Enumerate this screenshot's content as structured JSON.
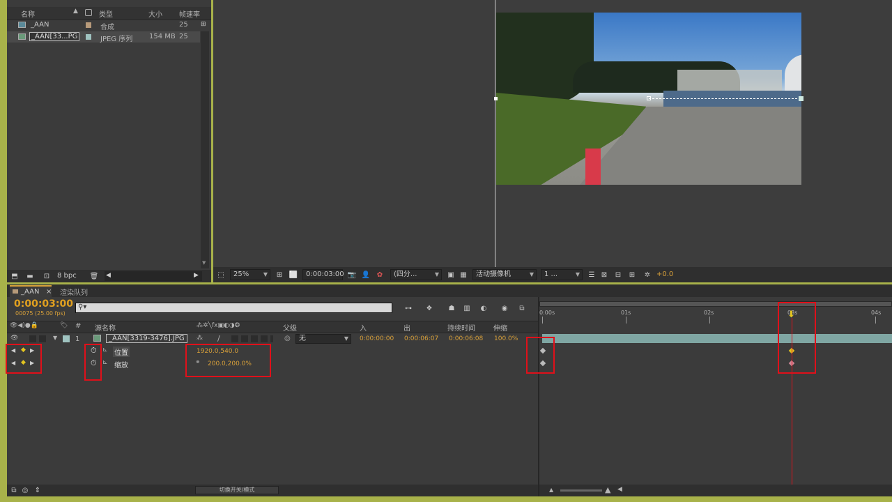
{
  "project": {
    "headers": {
      "name": "名称",
      "type": "类型",
      "size": "大小",
      "fps": "帧速率"
    },
    "rows": [
      {
        "name": "_AAN",
        "type": "合成",
        "size": "",
        "fps": "25"
      },
      {
        "name": "_AAN[33...PG",
        "type": "JPEG 序列",
        "size": "154 MB",
        "fps": "25"
      }
    ],
    "bpc": "8 bpc"
  },
  "viewer": {
    "zoom": "25%",
    "timecode": "0:00:03:00",
    "resolution": "(四分...",
    "camera": "活动摄像机",
    "views": "1 ...",
    "exposure": "+0.0"
  },
  "tabs": {
    "comp": "_AAN",
    "render_queue": "渲染队列"
  },
  "timeline": {
    "current_time": "0:00:03:00",
    "frame_info": "00075 (25.00 fps)",
    "search_placeholder": "",
    "columns": {
      "source_name": "源名称",
      "switches": "",
      "parent": "父级",
      "in": "入",
      "out": "出",
      "duration": "持续时间",
      "stretch": "伸缩"
    },
    "layer": {
      "index": "1",
      "name": "_AAN[3319-3476].JPG",
      "parent": "无",
      "in": "0:00:00:00",
      "out": "0:00:06:07",
      "duration": "0:00:06:08",
      "stretch": "100.0%"
    },
    "properties": [
      {
        "name": "位置",
        "value": "1920.0,540.0"
      },
      {
        "name": "缩放",
        "value": "200.0,200.0%"
      }
    ],
    "ruler": [
      "0:00s",
      "01s",
      "02s",
      "03s",
      "04s"
    ],
    "toggle_label": "切换开关/模式"
  },
  "colors": {
    "accent": "#d8a03a",
    "playhead": "#e0101a",
    "layer_bar": "#7fa6a3",
    "highlight": "#e0101a"
  }
}
